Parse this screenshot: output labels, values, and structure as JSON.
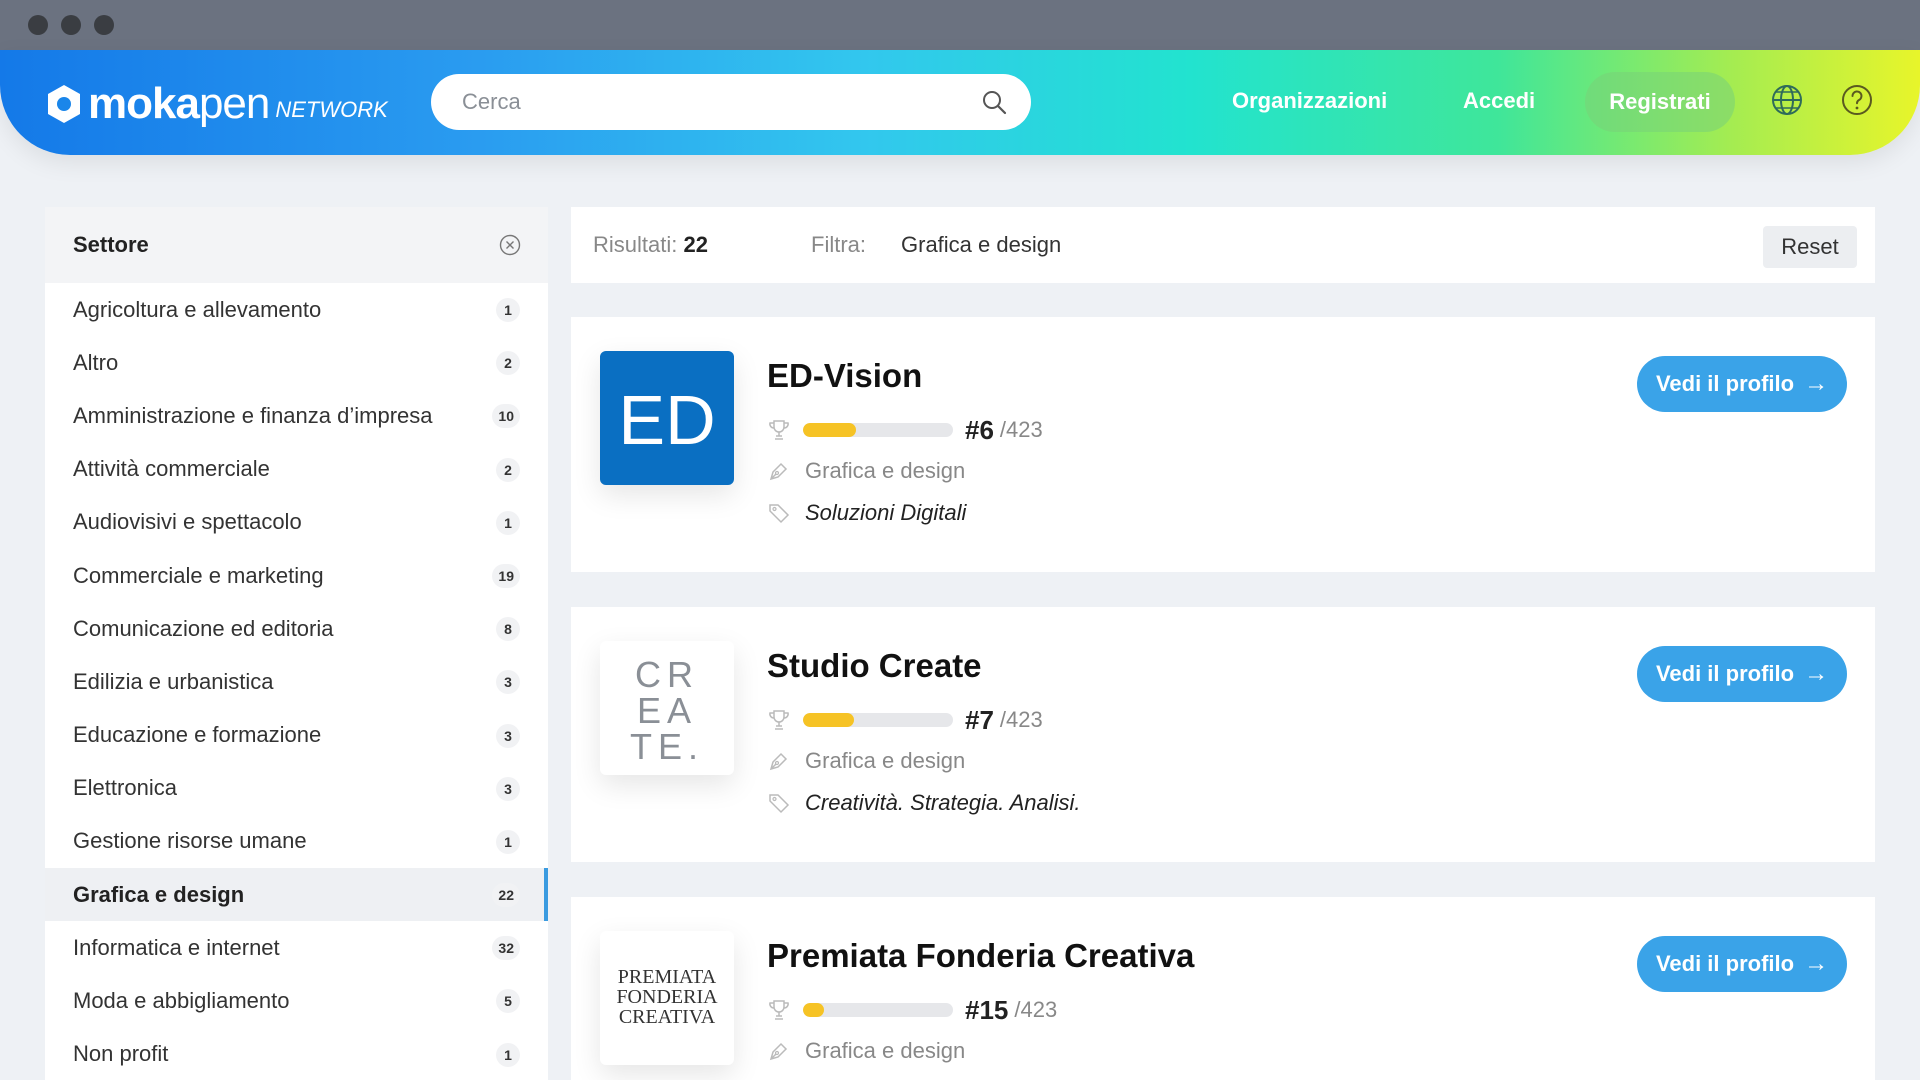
{
  "header": {
    "logo_bold": "moka",
    "logo_light": "pen",
    "logo_network": "NETWORK",
    "search_placeholder": "Cerca",
    "nav": {
      "organizations": "Organizzazioni",
      "login": "Accedi",
      "register": "Registrati"
    }
  },
  "sidebar": {
    "title": "Settore",
    "items": [
      {
        "label": "Agricoltura e allevamento",
        "count": "1"
      },
      {
        "label": "Altro",
        "count": "2"
      },
      {
        "label": "Amministrazione e finanza d’impresa",
        "count": "10"
      },
      {
        "label": "Attività commerciale",
        "count": "2"
      },
      {
        "label": "Audiovisivi e spettacolo",
        "count": "1"
      },
      {
        "label": "Commerciale e marketing",
        "count": "19"
      },
      {
        "label": "Comunicazione ed editoria",
        "count": "8"
      },
      {
        "label": "Edilizia e urbanistica",
        "count": "3"
      },
      {
        "label": "Educazione e formazione",
        "count": "3"
      },
      {
        "label": "Elettronica",
        "count": "3"
      },
      {
        "label": "Gestione risorse umane",
        "count": "1"
      },
      {
        "label": "Grafica e design",
        "count": "22"
      },
      {
        "label": "Informatica e internet",
        "count": "32"
      },
      {
        "label": "Moda e abbigliamento",
        "count": "5"
      },
      {
        "label": "Non profit",
        "count": "1"
      }
    ],
    "active_index": 11
  },
  "filterbar": {
    "results_label": "Risultati:",
    "results_count": "22",
    "filter_label": "Filtra:",
    "filter_value": "Grafica e design",
    "reset_label": "Reset"
  },
  "cards": [
    {
      "name": "ED-Vision",
      "rank": "#6",
      "rank_total": "/423",
      "rank_fraction": 0.35,
      "category": "Grafica e design",
      "tagline": "Soluzioni Digitali",
      "button": "Vedi il profilo",
      "logo_text": "ED"
    },
    {
      "name": "Studio Create",
      "rank": "#7",
      "rank_total": "/423",
      "rank_fraction": 0.34,
      "category": "Grafica e design",
      "tagline": "Creatività. Strategia. Analisi.",
      "button": "Vedi il profilo",
      "logo_text": [
        "CR",
        "EA",
        "TE."
      ]
    },
    {
      "name": "Premiata Fonderia Creativa",
      "rank": "#15",
      "rank_total": "/423",
      "rank_fraction": 0.14,
      "category": "Grafica e design",
      "tagline": "",
      "button": "Vedi il profilo",
      "logo_text": [
        "PREMIATA",
        "FONDERIA",
        "CREATIVA"
      ]
    }
  ],
  "colors": {
    "accent_blue": "#3aa3e8",
    "ed_blue": "#0a6fc2",
    "rank_yellow": "#f6c325"
  }
}
